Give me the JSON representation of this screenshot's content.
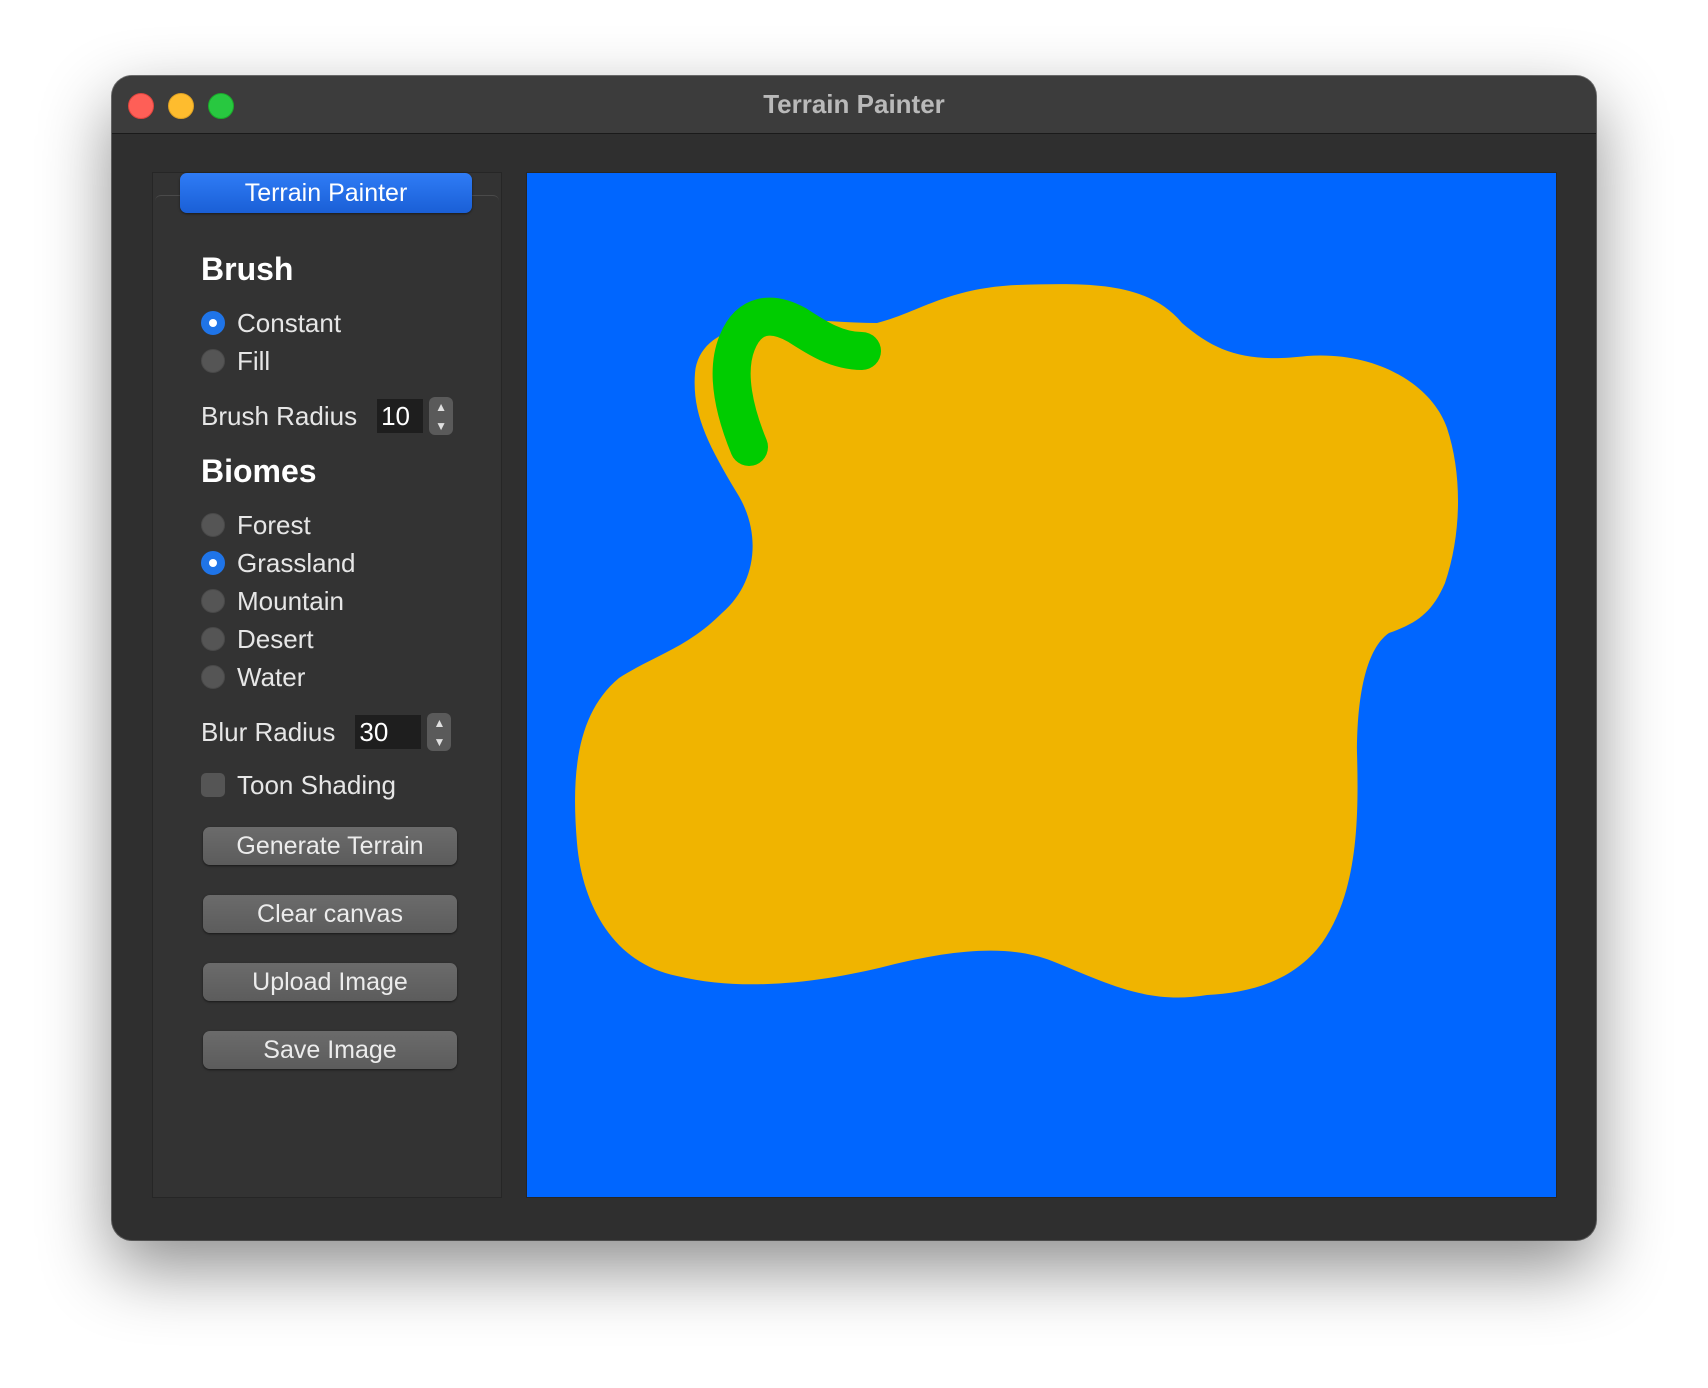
{
  "window": {
    "title": "Terrain Painter"
  },
  "panel": {
    "tab_label": "Terrain Painter",
    "brush": {
      "heading": "Brush",
      "modes": [
        {
          "label": "Constant",
          "selected": true
        },
        {
          "label": "Fill",
          "selected": false
        }
      ],
      "radius_label": "Brush Radius",
      "radius_value": "10"
    },
    "biomes": {
      "heading": "Biomes",
      "options": [
        {
          "label": "Forest",
          "selected": false
        },
        {
          "label": "Grassland",
          "selected": true
        },
        {
          "label": "Mountain",
          "selected": false
        },
        {
          "label": "Desert",
          "selected": false
        },
        {
          "label": "Water",
          "selected": false
        }
      ]
    },
    "blur": {
      "label": "Blur Radius",
      "value": "30"
    },
    "toon_shading": {
      "label": "Toon Shading",
      "checked": false
    },
    "buttons": {
      "generate": "Generate Terrain",
      "clear": "Clear canvas",
      "upload": "Upload Image",
      "save": "Save Image"
    }
  },
  "canvas": {
    "colors": {
      "water": "#0066ff",
      "desert": "#f0b400",
      "grassland": "#00cc00"
    }
  },
  "icons": {
    "stepper_up": "chevron-up-icon",
    "stepper_down": "chevron-down-icon"
  }
}
